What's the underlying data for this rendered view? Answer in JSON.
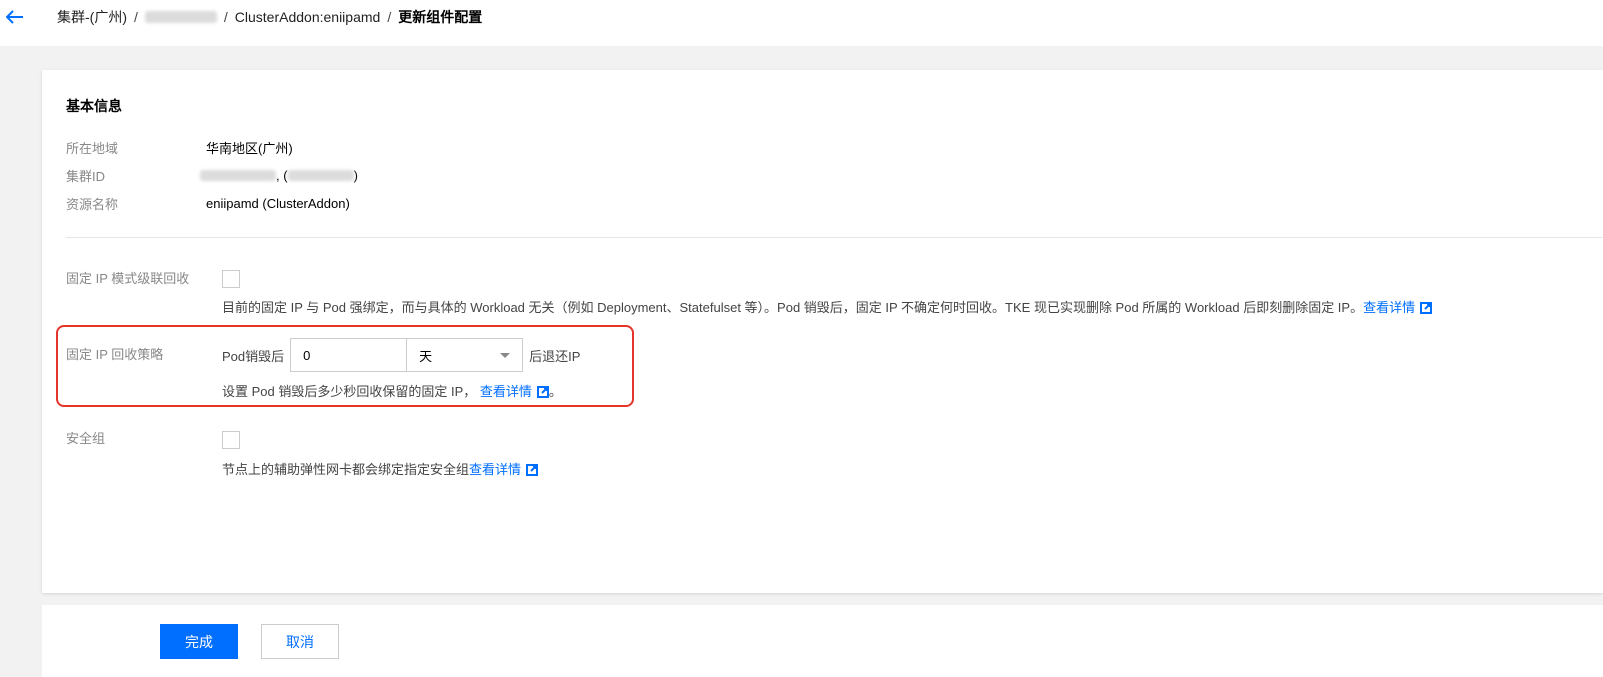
{
  "breadcrumb": {
    "cluster": "集群-(广州)",
    "separator": "/",
    "addon": "ClusterAddon:eniipamd",
    "current": "更新组件配置"
  },
  "basic_info": {
    "title": "基本信息",
    "rows": [
      {
        "label": "所在地域",
        "value": "华南地区(广州)"
      },
      {
        "label": "集群ID",
        "value_suffix": ")",
        "value_mid": ", ("
      },
      {
        "label": "资源名称",
        "value": "eniipamd (ClusterAddon)"
      }
    ]
  },
  "cascade_recycle": {
    "label": "固定 IP 模式级联回收",
    "checked": false,
    "help": "目前的固定 IP 与 Pod 强绑定，而与具体的 Workload 无关（例如 Deployment、Statefulset 等）。Pod 销毁后，固定 IP 不确定何时回收。TKE 现已实现删除 Pod 所属的 Workload 后即刻删除固定 IP。",
    "link": "查看详情"
  },
  "recycle_policy": {
    "label": "固定 IP 回收策略",
    "prefix": "Pod销毁后",
    "value": "0",
    "unit": "天",
    "suffix": "后退还IP",
    "help": "设置 Pod 销毁后多少秒回收保留的固定 IP，",
    "link": "查看详情",
    "help_end": "。"
  },
  "security_group": {
    "label": "安全组",
    "checked": false,
    "help": "节点上的辅助弹性网卡都会绑定指定安全组",
    "link": "查看详情"
  },
  "actions": {
    "confirm": "完成",
    "cancel": "取消"
  },
  "colors": {
    "primary": "#006eff",
    "highlight": "#e5352b"
  }
}
